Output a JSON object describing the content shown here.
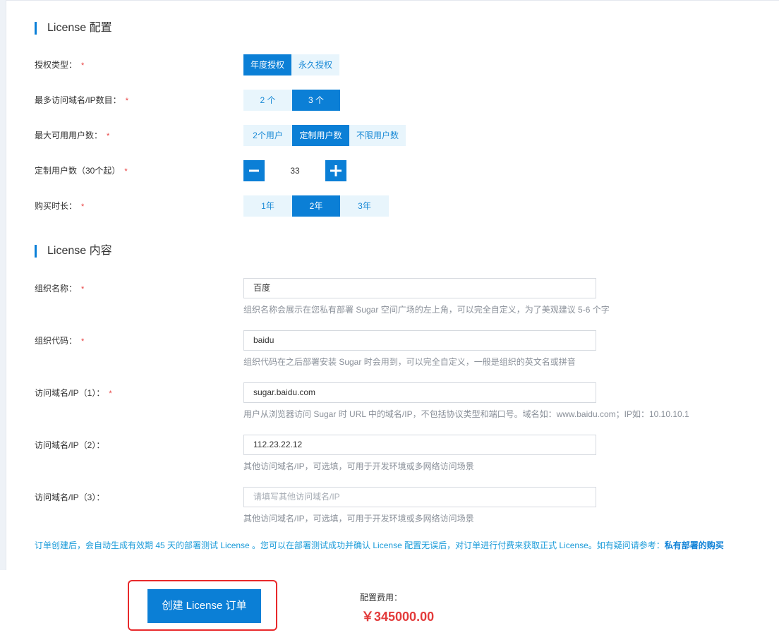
{
  "config_section": {
    "title": "License 配置"
  },
  "license_type": {
    "label": "授权类型：",
    "options": [
      "年度授权",
      "永久授权"
    ],
    "selected": "年度授权"
  },
  "max_domains": {
    "label": "最多访问域名/IP数目：",
    "options": [
      "2 个",
      "3 个"
    ],
    "selected": "3 个"
  },
  "max_users": {
    "label": "最大可用用户数：",
    "options": [
      "2个用户",
      "定制用户数",
      "不限用户数"
    ],
    "selected": "定制用户数"
  },
  "custom_users": {
    "label": "定制用户数（30个起）",
    "value": "33"
  },
  "duration": {
    "label": "购买时长：",
    "options": [
      "1年",
      "2年",
      "3年"
    ],
    "selected": "2年"
  },
  "content_section": {
    "title": "License 内容"
  },
  "org_name": {
    "label": "组织名称：",
    "value": "百度",
    "hint": "组织名称会展示在您私有部署 Sugar 空间广场的左上角，可以完全自定义，为了美观建议 5-6 个字"
  },
  "org_code": {
    "label": "组织代码：",
    "value": "baidu",
    "hint": "组织代码在之后部署安装 Sugar 时会用到，可以完全自定义，一般是组织的英文名或拼音"
  },
  "domain1": {
    "label": "访问域名/IP（1）：",
    "value": "sugar.baidu.com",
    "hint": "用户从浏览器访问 Sugar 时 URL 中的域名/IP，不包括协议类型和端口号。域名如：www.baidu.com；IP如：10.10.10.1"
  },
  "domain2": {
    "label": "访问域名/IP（2）：",
    "value": "112.23.22.12",
    "hint": "其他访问域名/IP，可选填，可用于开发环境或多网络访问场景"
  },
  "domain3": {
    "label": "访问域名/IP（3）：",
    "placeholder": "请填写其他访问域名/IP",
    "hint": "其他访问域名/IP，可选填，可用于开发环境或多网络访问场景"
  },
  "notice": {
    "text": "订单创建后，会自动生成有效期 45 天的部署测试 License 。您可以在部署测试成功并确认 License 配置无误后，对订单进行付费来获取正式 License。如有疑问请参考：",
    "link": "私有部署的购买"
  },
  "footer": {
    "create_button": "创建 License 订单",
    "fee_label": "配置费用：",
    "fee_value": "￥345000.00"
  },
  "colors": {
    "accent": "#0b7fd6",
    "option_bg": "#e8f5fc",
    "required": "#e83d3d",
    "price": "#e33b3b",
    "highlight_border": "#e8292b"
  }
}
